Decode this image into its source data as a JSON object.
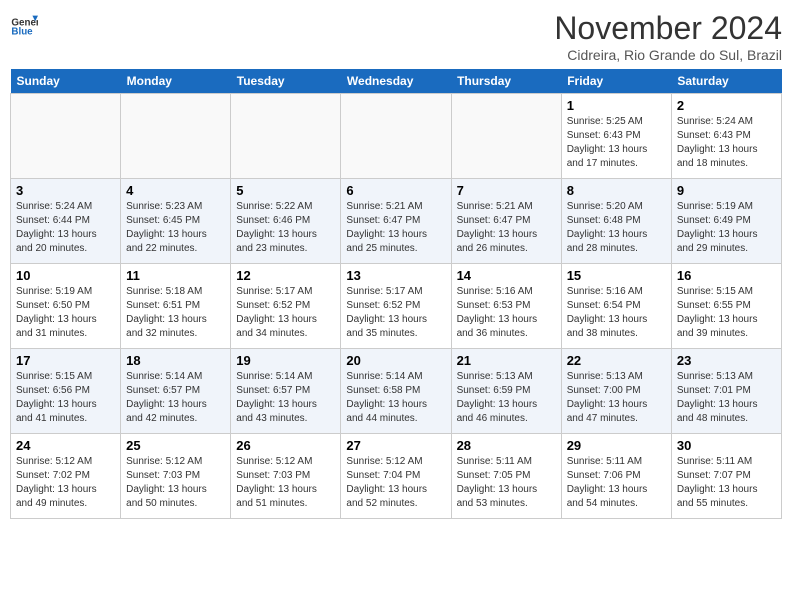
{
  "logo": {
    "line1": "General",
    "line2": "Blue"
  },
  "title": "November 2024",
  "location": "Cidreira, Rio Grande do Sul, Brazil",
  "weekdays": [
    "Sunday",
    "Monday",
    "Tuesday",
    "Wednesday",
    "Thursday",
    "Friday",
    "Saturday"
  ],
  "weeks": [
    [
      {
        "day": "",
        "info": ""
      },
      {
        "day": "",
        "info": ""
      },
      {
        "day": "",
        "info": ""
      },
      {
        "day": "",
        "info": ""
      },
      {
        "day": "",
        "info": ""
      },
      {
        "day": "1",
        "info": "Sunrise: 5:25 AM\nSunset: 6:43 PM\nDaylight: 13 hours and 17 minutes."
      },
      {
        "day": "2",
        "info": "Sunrise: 5:24 AM\nSunset: 6:43 PM\nDaylight: 13 hours and 18 minutes."
      }
    ],
    [
      {
        "day": "3",
        "info": "Sunrise: 5:24 AM\nSunset: 6:44 PM\nDaylight: 13 hours and 20 minutes."
      },
      {
        "day": "4",
        "info": "Sunrise: 5:23 AM\nSunset: 6:45 PM\nDaylight: 13 hours and 22 minutes."
      },
      {
        "day": "5",
        "info": "Sunrise: 5:22 AM\nSunset: 6:46 PM\nDaylight: 13 hours and 23 minutes."
      },
      {
        "day": "6",
        "info": "Sunrise: 5:21 AM\nSunset: 6:47 PM\nDaylight: 13 hours and 25 minutes."
      },
      {
        "day": "7",
        "info": "Sunrise: 5:21 AM\nSunset: 6:47 PM\nDaylight: 13 hours and 26 minutes."
      },
      {
        "day": "8",
        "info": "Sunrise: 5:20 AM\nSunset: 6:48 PM\nDaylight: 13 hours and 28 minutes."
      },
      {
        "day": "9",
        "info": "Sunrise: 5:19 AM\nSunset: 6:49 PM\nDaylight: 13 hours and 29 minutes."
      }
    ],
    [
      {
        "day": "10",
        "info": "Sunrise: 5:19 AM\nSunset: 6:50 PM\nDaylight: 13 hours and 31 minutes."
      },
      {
        "day": "11",
        "info": "Sunrise: 5:18 AM\nSunset: 6:51 PM\nDaylight: 13 hours and 32 minutes."
      },
      {
        "day": "12",
        "info": "Sunrise: 5:17 AM\nSunset: 6:52 PM\nDaylight: 13 hours and 34 minutes."
      },
      {
        "day": "13",
        "info": "Sunrise: 5:17 AM\nSunset: 6:52 PM\nDaylight: 13 hours and 35 minutes."
      },
      {
        "day": "14",
        "info": "Sunrise: 5:16 AM\nSunset: 6:53 PM\nDaylight: 13 hours and 36 minutes."
      },
      {
        "day": "15",
        "info": "Sunrise: 5:16 AM\nSunset: 6:54 PM\nDaylight: 13 hours and 38 minutes."
      },
      {
        "day": "16",
        "info": "Sunrise: 5:15 AM\nSunset: 6:55 PM\nDaylight: 13 hours and 39 minutes."
      }
    ],
    [
      {
        "day": "17",
        "info": "Sunrise: 5:15 AM\nSunset: 6:56 PM\nDaylight: 13 hours and 41 minutes."
      },
      {
        "day": "18",
        "info": "Sunrise: 5:14 AM\nSunset: 6:57 PM\nDaylight: 13 hours and 42 minutes."
      },
      {
        "day": "19",
        "info": "Sunrise: 5:14 AM\nSunset: 6:57 PM\nDaylight: 13 hours and 43 minutes."
      },
      {
        "day": "20",
        "info": "Sunrise: 5:14 AM\nSunset: 6:58 PM\nDaylight: 13 hours and 44 minutes."
      },
      {
        "day": "21",
        "info": "Sunrise: 5:13 AM\nSunset: 6:59 PM\nDaylight: 13 hours and 46 minutes."
      },
      {
        "day": "22",
        "info": "Sunrise: 5:13 AM\nSunset: 7:00 PM\nDaylight: 13 hours and 47 minutes."
      },
      {
        "day": "23",
        "info": "Sunrise: 5:13 AM\nSunset: 7:01 PM\nDaylight: 13 hours and 48 minutes."
      }
    ],
    [
      {
        "day": "24",
        "info": "Sunrise: 5:12 AM\nSunset: 7:02 PM\nDaylight: 13 hours and 49 minutes."
      },
      {
        "day": "25",
        "info": "Sunrise: 5:12 AM\nSunset: 7:03 PM\nDaylight: 13 hours and 50 minutes."
      },
      {
        "day": "26",
        "info": "Sunrise: 5:12 AM\nSunset: 7:03 PM\nDaylight: 13 hours and 51 minutes."
      },
      {
        "day": "27",
        "info": "Sunrise: 5:12 AM\nSunset: 7:04 PM\nDaylight: 13 hours and 52 minutes."
      },
      {
        "day": "28",
        "info": "Sunrise: 5:11 AM\nSunset: 7:05 PM\nDaylight: 13 hours and 53 minutes."
      },
      {
        "day": "29",
        "info": "Sunrise: 5:11 AM\nSunset: 7:06 PM\nDaylight: 13 hours and 54 minutes."
      },
      {
        "day": "30",
        "info": "Sunrise: 5:11 AM\nSunset: 7:07 PM\nDaylight: 13 hours and 55 minutes."
      }
    ]
  ]
}
